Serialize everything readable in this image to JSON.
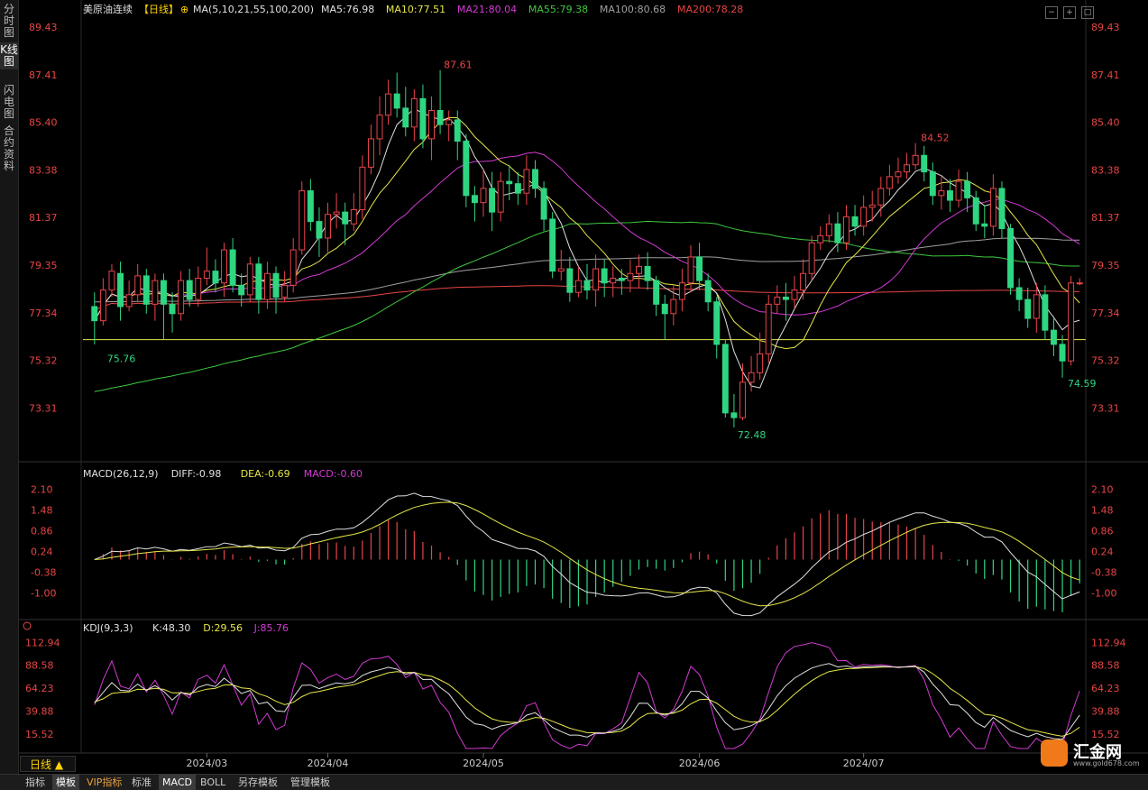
{
  "sidebar": [
    {
      "label": "分时图",
      "active": false
    },
    {
      "label": "K线图",
      "active": true
    },
    {
      "label": "闪电图",
      "active": false
    },
    {
      "label": "合约资料",
      "active": false
    }
  ],
  "toolbar_icons": [
    "zoom-out-icon",
    "zoom-in-icon",
    "fullscreen-icon"
  ],
  "main": {
    "header": {
      "instrument": "美原油连续",
      "period_tag": "【日线】",
      "ma_params": "MA(5,10,21,55,100,200)",
      "items": [
        {
          "text": "MA5:76.98",
          "color": "#e0e0e0"
        },
        {
          "text": "MA10:77.51",
          "color": "#e6e64a"
        },
        {
          "text": "MA21:80.04",
          "color": "#d23ad2"
        },
        {
          "text": "MA55:79.38",
          "color": "#3ec83e"
        },
        {
          "text": "MA100:80.68",
          "color": "#a0a0a0"
        },
        {
          "text": "MA200:78.28",
          "color": "#e84545"
        }
      ]
    },
    "axis_labels": [
      "89.43",
      "87.41",
      "85.40",
      "83.38",
      "81.37",
      "79.35",
      "77.34",
      "75.32",
      "73.31"
    ],
    "annotations": {
      "high1": "87.61",
      "high2": "84.52",
      "low1": "75.76",
      "low2": "72.48",
      "low3": "74.59"
    }
  },
  "macd": {
    "header": [
      {
        "text": "MACD(26,12,9)",
        "color": "#e0e0e0"
      },
      {
        "text": "DIFF:-0.98",
        "color": "#e0e0e0"
      },
      {
        "text": "DEA:-0.69",
        "color": "#e6e64a"
      },
      {
        "text": "MACD:-0.60",
        "color": "#d23ad2"
      }
    ],
    "axis_labels": [
      "2.10",
      "1.48",
      "0.86",
      "0.24",
      "-0.38",
      "-1.00"
    ]
  },
  "kdj": {
    "header": [
      {
        "text": "KDJ(9,3,3)",
        "color": "#e0e0e0"
      },
      {
        "text": "K:48.30",
        "color": "#e0e0e0"
      },
      {
        "text": "D:29.56",
        "color": "#e6e64a"
      },
      {
        "text": "J:85.76",
        "color": "#d23ad2"
      }
    ],
    "axis_labels": [
      "112.94",
      "88.58",
      "64.23",
      "39.88",
      "15.52"
    ]
  },
  "x_axis_labels": [
    "2024/03",
    "2024/04",
    "2024/05",
    "2024/06",
    "2024/07"
  ],
  "period_button": "日线 ▲",
  "bottom_tabs": [
    {
      "label": "指标",
      "on": false,
      "vip": false
    },
    {
      "label": "模板",
      "on": true,
      "vip": false
    },
    {
      "label": "VIP指标",
      "on": false,
      "vip": true
    },
    {
      "label": "标准",
      "on": false,
      "vip": false
    },
    {
      "label": "MACD",
      "on": true,
      "vip": false
    },
    {
      "label": "BOLL",
      "on": false,
      "vip": false
    },
    {
      "label": "另存模板",
      "on": false,
      "vip": false
    },
    {
      "label": "管理模板",
      "on": false,
      "vip": false
    }
  ],
  "logo": {
    "name": "汇金网",
    "url": "www.gold678.com"
  },
  "colors": {
    "up": "#e8454a",
    "down": "#2fd682",
    "ma5": "#e0e0e0",
    "ma10": "#e6e64a",
    "ma21": "#d23ad2",
    "ma55": "#3ec83e",
    "ma100": "#a0a0a0",
    "ma200": "#e84545",
    "support": "#e6e64a"
  },
  "chart_data": {
    "type": "candlestick",
    "price_range": [
      71.3,
      89.43
    ],
    "support_level": 76.2,
    "candles": [
      [
        77.6,
        77.0,
        78.2,
        76.0
      ],
      [
        77.0,
        78.3,
        78.8,
        76.8
      ],
      [
        78.3,
        79.1,
        79.4,
        78.0
      ],
      [
        79.0,
        77.6,
        79.5,
        77.0
      ],
      [
        77.6,
        78.1,
        78.7,
        77.4
      ],
      [
        78.1,
        78.9,
        79.4,
        77.8
      ],
      [
        78.9,
        77.7,
        79.2,
        77.3
      ],
      [
        77.7,
        78.7,
        79.0,
        77.0
      ],
      [
        78.7,
        77.7,
        79.0,
        76.2
      ],
      [
        77.7,
        77.3,
        78.2,
        76.5
      ],
      [
        77.3,
        78.7,
        79.1,
        77.0
      ],
      [
        78.7,
        77.9,
        79.2,
        77.6
      ],
      [
        77.9,
        78.8,
        79.3,
        77.6
      ],
      [
        78.8,
        79.1,
        80.1,
        78.5
      ],
      [
        79.1,
        78.6,
        79.6,
        78.2
      ],
      [
        78.6,
        80.0,
        80.3,
        78.0
      ],
      [
        80.0,
        78.5,
        80.5,
        78.2
      ],
      [
        78.5,
        78.1,
        79.0,
        77.6
      ],
      [
        78.1,
        79.4,
        79.7,
        77.8
      ],
      [
        79.4,
        77.9,
        79.7,
        77.3
      ],
      [
        77.9,
        79.0,
        79.5,
        77.5
      ],
      [
        79.0,
        78.0,
        79.3,
        77.3
      ],
      [
        78.0,
        78.5,
        79.1,
        77.8
      ],
      [
        78.5,
        80.0,
        80.5,
        78.2
      ],
      [
        80.0,
        82.5,
        82.9,
        79.8
      ],
      [
        82.5,
        81.2,
        83.0,
        80.8
      ],
      [
        81.2,
        80.5,
        81.8,
        79.7
      ],
      [
        80.5,
        81.5,
        82.0,
        79.9
      ],
      [
        81.5,
        81.6,
        82.4,
        80.9
      ],
      [
        81.6,
        81.1,
        82.0,
        80.2
      ],
      [
        81.1,
        81.7,
        82.4,
        80.8
      ],
      [
        81.7,
        83.5,
        84.0,
        81.3
      ],
      [
        83.5,
        84.7,
        85.3,
        83.2
      ],
      [
        84.7,
        85.7,
        86.5,
        84.0
      ],
      [
        85.7,
        86.6,
        87.2,
        85.3
      ],
      [
        86.6,
        86.0,
        87.5,
        85.6
      ],
      [
        86.0,
        85.2,
        86.9,
        84.8
      ],
      [
        85.2,
        86.4,
        86.8,
        84.6
      ],
      [
        86.4,
        84.7,
        87.0,
        84.3
      ],
      [
        84.7,
        85.9,
        86.5,
        83.8
      ],
      [
        85.9,
        85.3,
        87.61,
        84.9
      ],
      [
        85.3,
        85.5,
        85.9,
        84.6
      ],
      [
        85.5,
        84.6,
        85.9,
        83.8
      ],
      [
        84.6,
        82.3,
        84.9,
        81.8
      ],
      [
        82.3,
        82.0,
        82.7,
        81.2
      ],
      [
        82.0,
        82.6,
        83.4,
        81.4
      ],
      [
        82.6,
        81.6,
        83.3,
        80.8
      ],
      [
        81.6,
        82.9,
        83.3,
        81.2
      ],
      [
        82.9,
        82.8,
        83.6,
        82.1
      ],
      [
        82.8,
        82.4,
        83.3,
        81.9
      ],
      [
        82.4,
        83.4,
        84.0,
        81.9
      ],
      [
        83.4,
        82.6,
        83.8,
        82.2
      ],
      [
        82.6,
        81.3,
        82.9,
        80.8
      ],
      [
        81.3,
        79.1,
        81.6,
        78.8
      ],
      [
        79.1,
        79.2,
        80.0,
        78.7
      ],
      [
        79.2,
        78.2,
        79.7,
        77.8
      ],
      [
        78.2,
        78.7,
        79.3,
        78.0
      ],
      [
        78.7,
        78.3,
        79.4,
        77.9
      ],
      [
        78.3,
        79.2,
        79.8,
        77.6
      ],
      [
        79.2,
        78.6,
        79.6,
        78.0
      ],
      [
        78.6,
        78.8,
        79.3,
        78.0
      ],
      [
        78.8,
        78.7,
        79.2,
        78.1
      ],
      [
        78.7,
        79.0,
        79.6,
        78.2
      ],
      [
        79.0,
        79.3,
        79.8,
        78.4
      ],
      [
        79.3,
        78.7,
        79.9,
        78.3
      ],
      [
        78.7,
        77.7,
        78.9,
        77.2
      ],
      [
        77.7,
        77.3,
        78.1,
        76.2
      ],
      [
        77.3,
        77.9,
        78.5,
        76.8
      ],
      [
        77.9,
        78.6,
        79.2,
        77.4
      ],
      [
        78.6,
        79.7,
        80.2,
        78.2
      ],
      [
        79.7,
        78.7,
        80.3,
        78.3
      ],
      [
        78.7,
        77.8,
        79.0,
        77.4
      ],
      [
        77.8,
        76.0,
        78.0,
        75.4
      ],
      [
        76.0,
        73.1,
        76.2,
        72.9
      ],
      [
        73.1,
        72.9,
        73.9,
        72.48
      ],
      [
        72.9,
        74.4,
        75.2,
        72.8
      ],
      [
        74.4,
        74.8,
        75.5,
        74.0
      ],
      [
        74.8,
        75.6,
        76.5,
        74.5
      ],
      [
        75.6,
        77.7,
        78.1,
        75.2
      ],
      [
        77.7,
        78.0,
        78.5,
        77.3
      ],
      [
        78.0,
        77.9,
        78.6,
        77.0
      ],
      [
        77.9,
        78.3,
        78.9,
        77.5
      ],
      [
        78.3,
        79.0,
        79.6,
        77.9
      ],
      [
        79.0,
        80.3,
        80.6,
        78.7
      ],
      [
        80.3,
        80.6,
        81.0,
        80.0
      ],
      [
        80.6,
        81.1,
        81.5,
        80.3
      ],
      [
        81.1,
        80.3,
        81.6,
        79.9
      ],
      [
        80.3,
        81.4,
        81.9,
        80.0
      ],
      [
        81.4,
        81.0,
        81.9,
        80.6
      ],
      [
        81.0,
        81.8,
        82.3,
        80.6
      ],
      [
        81.8,
        81.9,
        82.5,
        81.2
      ],
      [
        81.9,
        82.6,
        83.1,
        81.4
      ],
      [
        82.6,
        83.1,
        83.6,
        82.3
      ],
      [
        83.1,
        83.3,
        83.9,
        82.8
      ],
      [
        83.3,
        83.6,
        84.1,
        83.0
      ],
      [
        83.6,
        84.0,
        84.52,
        83.4
      ],
      [
        84.0,
        83.3,
        84.4,
        82.9
      ],
      [
        83.3,
        82.3,
        83.7,
        81.9
      ],
      [
        82.3,
        82.5,
        83.1,
        81.7
      ],
      [
        82.5,
        82.1,
        83.0,
        81.6
      ],
      [
        82.1,
        82.9,
        83.4,
        81.8
      ],
      [
        82.9,
        82.2,
        83.3,
        81.6
      ],
      [
        82.2,
        81.1,
        82.5,
        80.8
      ],
      [
        81.1,
        81.0,
        81.9,
        80.5
      ],
      [
        81.0,
        82.6,
        83.2,
        80.6
      ],
      [
        82.6,
        80.9,
        82.9,
        80.5
      ],
      [
        80.9,
        78.4,
        81.1,
        78.1
      ],
      [
        78.4,
        77.9,
        78.8,
        77.4
      ],
      [
        77.9,
        77.1,
        78.4,
        76.7
      ],
      [
        77.1,
        78.1,
        78.6,
        76.5
      ],
      [
        78.1,
        76.6,
        78.5,
        76.2
      ],
      [
        76.6,
        76.0,
        77.2,
        75.5
      ],
      [
        76.0,
        75.3,
        76.4,
        74.59
      ],
      [
        75.3,
        78.6,
        78.9,
        75.1
      ],
      [
        78.6,
        78.6,
        78.8,
        78.5
      ]
    ],
    "xlabel": "",
    "ylabel": "",
    "macd_range": [
      -1.6,
      2.3
    ],
    "kdj_range": [
      0,
      120
    ]
  }
}
